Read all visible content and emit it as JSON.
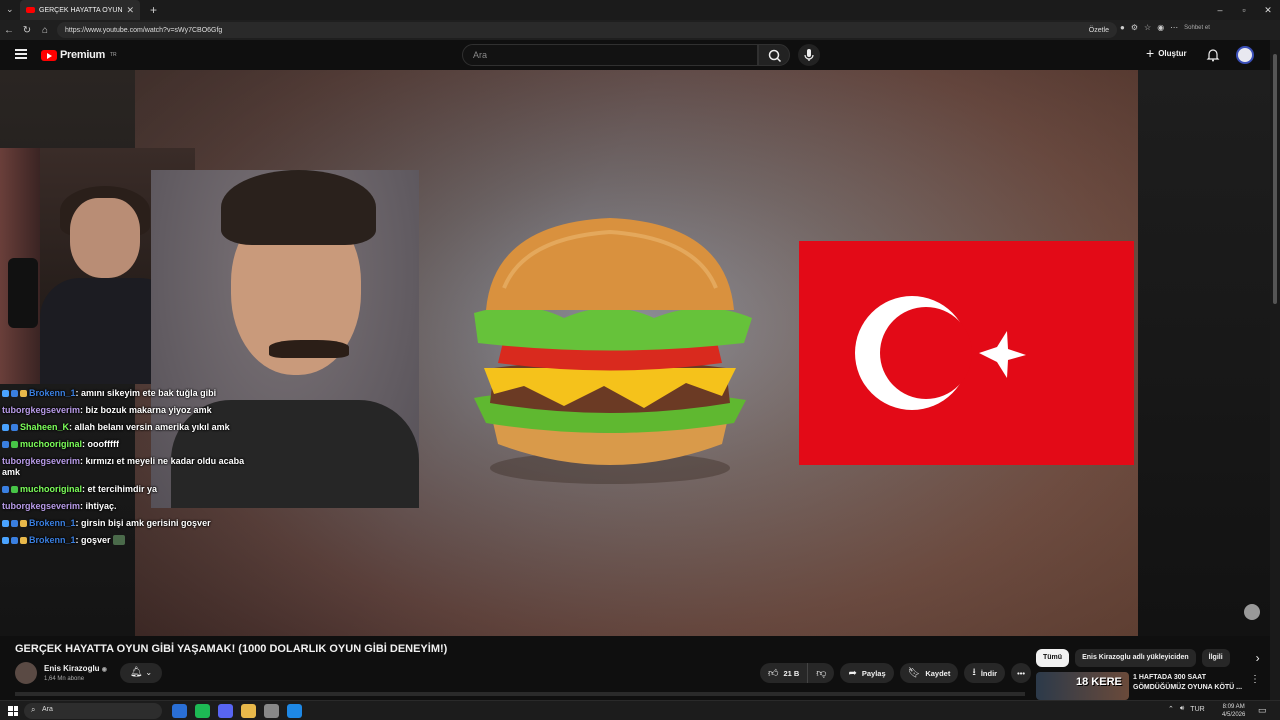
{
  "browser": {
    "tab_title": "GERÇEK HAYATTA OYUN GİBİ",
    "tab_close": "✕",
    "new_tab": "+",
    "url": "https://www.youtube.com/watch?v=sWy7CBO6Gfg",
    "summarize_label": "Özetle",
    "chat_label": "Sohbet et",
    "window_controls": [
      "–",
      "▫",
      "✕"
    ]
  },
  "yt_header": {
    "logo_text": "Premium",
    "logo_region": "TR",
    "search_placeholder": "Ara",
    "create_label": "Oluştur"
  },
  "stream_chat": [
    {
      "user": "Brokenn_1",
      "message": ": amını sikeyim ete bak tuğla gibi",
      "color": "#3a7fe0",
      "badges": [
        "#4aa3ff",
        "#3a7fe0",
        "#e8b84a"
      ]
    },
    {
      "user": "tuborgkegseverim",
      "message": ": biz bozuk makarna yiyoz amk",
      "color": "#b89be8",
      "badges": []
    },
    {
      "user": "Shaheen_K",
      "message": ": allah belanı versin amerika yıkıl amk",
      "color": "#7cff5a",
      "badges": [
        "#4aa3ff",
        "#3a7fe0"
      ]
    },
    {
      "user": "muchooriginal",
      "message": ": ooofffff",
      "color": "#7cff5a",
      "badges": [
        "#3a7fe0",
        "#47c447"
      ]
    },
    {
      "user": "tuborgkegseverim",
      "message": ": kırmızı et meyeli ne kadar oldu acaba amk",
      "color": "#b89be8",
      "badges": []
    },
    {
      "user": "muchooriginal",
      "message": ": et tercihimdir ya",
      "color": "#7cff5a",
      "badges": [
        "#3a7fe0",
        "#47c447"
      ]
    },
    {
      "user": "tuborgkegseverim",
      "message": ": ihtiyaç.",
      "color": "#b89be8",
      "badges": []
    },
    {
      "user": "Brokenn_1",
      "message": ": girsin bişi amk gerisini goşver",
      "color": "#3a7fe0",
      "badges": [
        "#4aa3ff",
        "#3a7fe0",
        "#e8b84a"
      ]
    },
    {
      "user": "Brokenn_1",
      "message": ": goşver",
      "color": "#3a7fe0",
      "badges": [
        "#4aa3ff",
        "#3a7fe0",
        "#e8b84a"
      ],
      "emote": true
    }
  ],
  "video": {
    "title": "GERÇEK HAYATTA OYUN GİBİ YAŞAMAK! (1000 DOLARLIK OYUN GİBİ DENEYİM!)",
    "channel": "Enis Kirazoglu",
    "verified_mark": "◉",
    "subscribers": "1,64 Mn abone",
    "likes": "21 B",
    "share_label": "Paylaş",
    "save_label": "Kaydet",
    "download_label": "İndir",
    "more_label": "•••"
  },
  "chips": [
    "Tümü",
    "Enis Kirazoglu adlı yükleyiciden",
    "İlgili"
  ],
  "recommended": {
    "thumb_text": "18 KERE",
    "title": "1 HAFTADA 300 SAAT GÖMDÜĞÜMÜZ OYUNA KÖTÜ ..."
  },
  "taskbar": {
    "search_placeholder": "Ara",
    "lang": "TUR",
    "time": "8:09 AM",
    "date": "4/5/2026",
    "apps": [
      "#2a6fd6",
      "#1db954",
      "#5865f2",
      "#e8b84a",
      "#888888",
      "#1e88e5"
    ]
  },
  "colors": {
    "youtube_red": "#ff0000",
    "flag_red": "#e30a17",
    "background": "#0f0f0f"
  }
}
